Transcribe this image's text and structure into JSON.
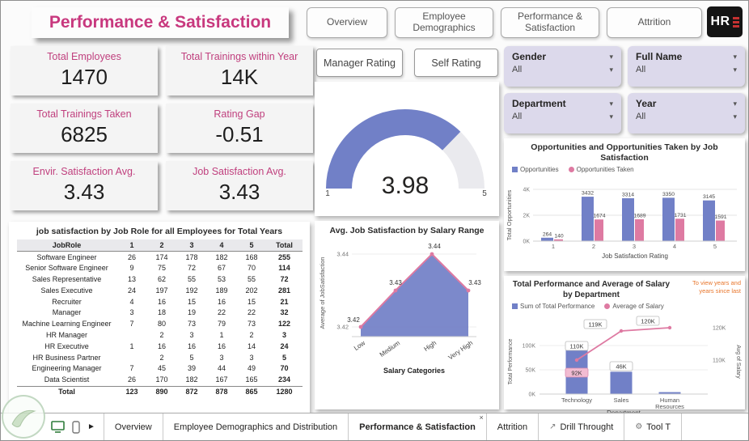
{
  "header": {
    "title": "Performance & Satisfaction",
    "nav": [
      "Overview",
      "Employee Demographics",
      "Performance & Satisfaction",
      "Attrition"
    ],
    "logo_text": "HR"
  },
  "kpis": [
    {
      "label": "Total Employees",
      "value": "1470"
    },
    {
      "label": "Total Trainings within Year",
      "value": "14K"
    },
    {
      "label": "Total Trainings Taken",
      "value": "6825"
    },
    {
      "label": "Rating Gap",
      "value": "-0.51"
    },
    {
      "label": "Envir. Satisfaction Avg.",
      "value": "3.43"
    },
    {
      "label": "Job Satisfaction Avg.",
      "value": "3.43"
    }
  ],
  "rating_buttons": [
    "Manager Rating",
    "Self Rating"
  ],
  "gauge": {
    "value": "3.98",
    "min": 1,
    "max": 5,
    "min_label": "1",
    "max_label": "5",
    "color": "#7180C7"
  },
  "filters": [
    {
      "label": "Gender",
      "value": "All"
    },
    {
      "label": "Full Name",
      "value": "All"
    },
    {
      "label": "Department",
      "value": "All"
    },
    {
      "label": "Year",
      "value": "All"
    }
  ],
  "icons": {
    "chevron": "▾",
    "scroll_right": "►",
    "close": "×"
  },
  "chart_data": {
    "opportunities": {
      "type": "bar",
      "title": "Opportunities and Opportunities Taken by Job Satisfaction",
      "categories": [
        "1",
        "2",
        "3",
        "4",
        "5"
      ],
      "series": [
        {
          "name": "Opportunities",
          "color": "#7180C7",
          "values": [
            264,
            3432,
            3314,
            3350,
            3145
          ]
        },
        {
          "name": "Opportunities Taken",
          "color": "#DE7AA2",
          "values": [
            140,
            1674,
            1689,
            1731,
            1591
          ]
        }
      ],
      "ylabel": "Total Opportunities",
      "xlabel": "Job Satisfaction Rating",
      "ymax": 4000,
      "y_ticks": [
        {
          "label": "0K",
          "v": 0
        },
        {
          "label": "2K",
          "v": 2000
        },
        {
          "label": "4K",
          "v": 4000
        }
      ]
    },
    "salary": {
      "type": "area",
      "title": "Avg. Job Satisfaction by Salary Range",
      "categories": [
        "Low",
        "Medium",
        "High",
        "Very High"
      ],
      "values": [
        3.42,
        3.43,
        3.44,
        3.43
      ],
      "labels": [
        "3.42",
        "3.43",
        "3.44",
        "3.43"
      ],
      "ylabel": "Average of JobSatisfaction",
      "xlabel": "Salary Categories",
      "y_ticks": [
        {
          "label": "3.44",
          "v": 3.44
        },
        {
          "label": "3.42",
          "v": 3.42
        }
      ],
      "area_color": "#7583C8",
      "line_color": "#DE7AA2"
    },
    "performance": {
      "type": "combo",
      "title": "Total Performance and Average of Salary by Department",
      "note": [
        "To view years and",
        "years since last"
      ],
      "categories": [
        "Technology",
        "Sales",
        "Human Resources"
      ],
      "bar_series": {
        "name": "Sum of Total Performance",
        "color": "#7180C7",
        "values_k": [
          92,
          46,
          4
        ],
        "labels": [
          "92K",
          "46K",
          ""
        ]
      },
      "line_series": {
        "name": "Average of Salary",
        "color": "#DE7AA2",
        "values_k": [
          110,
          119,
          120
        ],
        "labels": [
          "110K",
          "119K",
          "120K"
        ]
      },
      "left_axis": {
        "title": "Total Performance",
        "ticks": [
          {
            "label": "0K",
            "v": 0
          },
          {
            "label": "50K",
            "v": 50
          },
          {
            "label": "100K",
            "v": 100
          }
        ]
      },
      "right_axis": {
        "title": "Avg of Salary",
        "ticks": [
          {
            "label": "110K",
            "v": 110
          },
          {
            "label": "120K",
            "v": 120
          }
        ]
      },
      "xlabel": "Department"
    }
  },
  "table": {
    "title": "job satisfaction by Job Role for all Employees for Total Years",
    "columns": [
      "JobRole",
      "1",
      "2",
      "3",
      "4",
      "5",
      "Total"
    ],
    "rows": [
      [
        "Software Engineer",
        "26",
        "174",
        "178",
        "182",
        "168",
        "255"
      ],
      [
        "Senior Software Engineer",
        "9",
        "75",
        "72",
        "67",
        "70",
        "114"
      ],
      [
        "Sales Representative",
        "13",
        "62",
        "55",
        "53",
        "55",
        "72"
      ],
      [
        "Sales Executive",
        "24",
        "197",
        "192",
        "189",
        "202",
        "281"
      ],
      [
        "Recruiter",
        "4",
        "16",
        "15",
        "16",
        "15",
        "21"
      ],
      [
        "Manager",
        "3",
        "18",
        "19",
        "22",
        "22",
        "32"
      ],
      [
        "Machine Learning Engineer",
        "7",
        "80",
        "73",
        "79",
        "73",
        "122"
      ],
      [
        "HR Manager",
        "",
        "2",
        "3",
        "1",
        "2",
        "3"
      ],
      [
        "HR Executive",
        "1",
        "16",
        "16",
        "16",
        "14",
        "24"
      ],
      [
        "HR Business Partner",
        "",
        "2",
        "5",
        "3",
        "3",
        "5"
      ],
      [
        "Engineering Manager",
        "7",
        "45",
        "39",
        "44",
        "49",
        "70"
      ],
      [
        "Data Scientist",
        "26",
        "170",
        "182",
        "167",
        "165",
        "234"
      ]
    ],
    "total_row": [
      "Total",
      "123",
      "890",
      "872",
      "878",
      "865",
      "1280"
    ]
  },
  "bottom_bar": {
    "tabs": [
      {
        "label": "Overview",
        "active": false
      },
      {
        "label": "Employee Demographics and Distribution",
        "active": false
      },
      {
        "label": "Performance & Satisfaction",
        "active": true
      },
      {
        "label": "Attrition",
        "active": false
      },
      {
        "label": "Drill Throught",
        "active": false,
        "icon": "↗"
      },
      {
        "label": "Tool T",
        "active": false,
        "icon": "⚙"
      }
    ]
  }
}
